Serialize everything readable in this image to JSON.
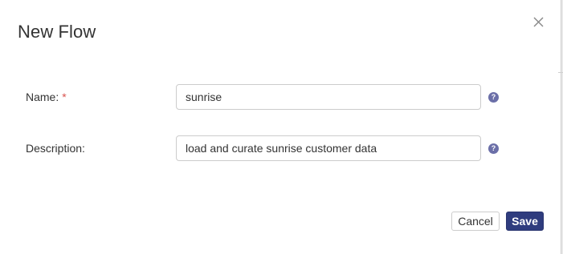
{
  "dialog": {
    "title": "New Flow",
    "close_glyph": "×"
  },
  "form": {
    "name": {
      "label": "Name:",
      "required_mark": "*",
      "value": "sunrise",
      "help_glyph": "?"
    },
    "description": {
      "label": "Description:",
      "value": "load and curate sunrise customer data",
      "help_glyph": "?"
    }
  },
  "actions": {
    "cancel_label": "Cancel",
    "save_label": "Save"
  },
  "colors": {
    "primary": "#2f3c7e",
    "help_icon": "#6b6fa8",
    "required": "#d9534f"
  }
}
